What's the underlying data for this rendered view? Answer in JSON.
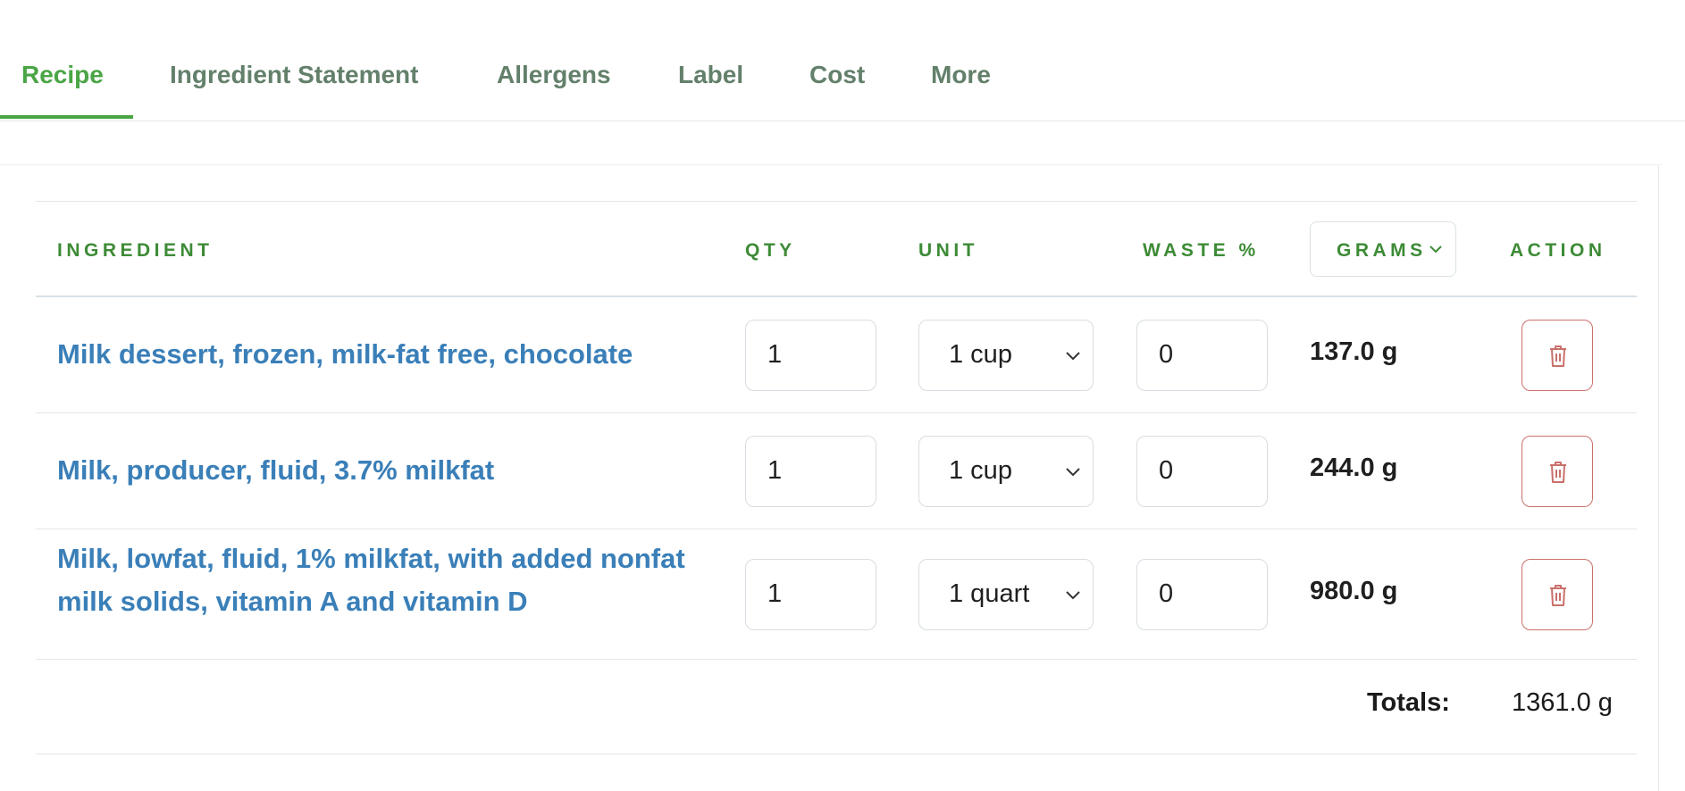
{
  "tabs": [
    {
      "label": "Recipe",
      "active": true
    },
    {
      "label": "Ingredient Statement",
      "active": false
    },
    {
      "label": "Allergens",
      "active": false
    },
    {
      "label": "Label",
      "active": false
    },
    {
      "label": "Cost",
      "active": false
    },
    {
      "label": "More",
      "active": false
    }
  ],
  "table": {
    "headers": {
      "ingredient": "INGREDIENT",
      "qty": "QTY",
      "unit": "UNIT",
      "waste": "WASTE %",
      "grams": "GRAMS",
      "action": "ACTION"
    },
    "rows": [
      {
        "ingredient": "Milk dessert, frozen, milk-fat free, chocolate",
        "qty": "1",
        "unit": "1 cup",
        "waste": "0",
        "grams": "137.0 g"
      },
      {
        "ingredient": "Milk, producer, fluid, 3.7% milkfat",
        "qty": "1",
        "unit": "1 cup",
        "waste": "0",
        "grams": "244.0 g"
      },
      {
        "ingredient": "Milk, lowfat, fluid, 1% milkfat, with added nonfat milk solids, vitamin A and vitamin D",
        "qty": "1",
        "unit": "1 quart",
        "waste": "0",
        "grams": "980.0 g"
      }
    ],
    "totals": {
      "label": "Totals:",
      "value": "1361.0 g"
    }
  },
  "icons": {
    "grams_sort": "chevron-down-icon",
    "unit_dropdown": "chevron-down-icon",
    "delete": "trash-icon"
  },
  "colors": {
    "accent": "#4aa545",
    "header_text": "#3d8b36",
    "link": "#3a7fb8",
    "delete_border": "#c9706b"
  }
}
